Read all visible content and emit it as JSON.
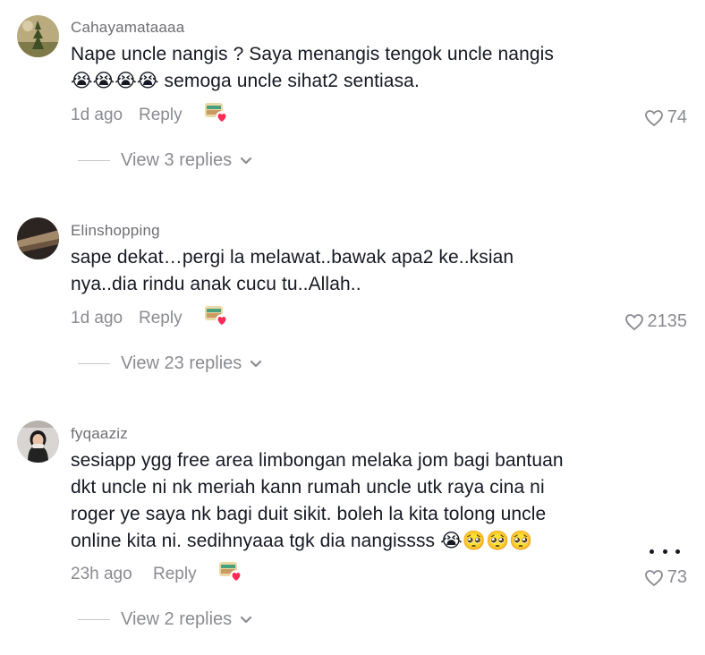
{
  "comments": [
    {
      "username": "Cahayamataaaa",
      "text": "Nape uncle nangis ? Saya menangis tengok uncle nangis\n😭😭😭😭 semoga uncle sihat2 sentiasa.",
      "time": "1d ago",
      "reply_label": "Reply",
      "likes": "74",
      "view_replies": "View 3 replies"
    },
    {
      "username": "Elinshopping",
      "text": "sape dekat…pergi la melawat..bawak apa2 ke..ksian\nnya..dia rindu anak cucu tu..Allah..",
      "time": "1d ago",
      "reply_label": "Reply",
      "likes": "2135",
      "view_replies": "View 23 replies"
    },
    {
      "username": "fyqaaziz",
      "text": "sesiapp ygg free area limbongan melaka jom bagi bantuan\ndkt uncle ni nk meriah kann rumah uncle utk raya cina ni\nroger ye saya nk bagi duit sikit. boleh la kita tolong uncle\nonline kita ni. sedihnyaaa tgk dia nangissss 😭🥺🥺🥺",
      "time": "23h ago",
      "reply_label": "Reply",
      "likes": "73",
      "view_replies": "View 2 replies"
    }
  ],
  "icons": {
    "like": "heart-outline-icon",
    "creator_liked": "creator-liked-badge-icon",
    "expand": "chevron-down-icon",
    "more": "more-options-icon"
  },
  "colors": {
    "text": "#161823",
    "secondary": "#8a8b91",
    "heart_badge": "#fe2c55"
  }
}
